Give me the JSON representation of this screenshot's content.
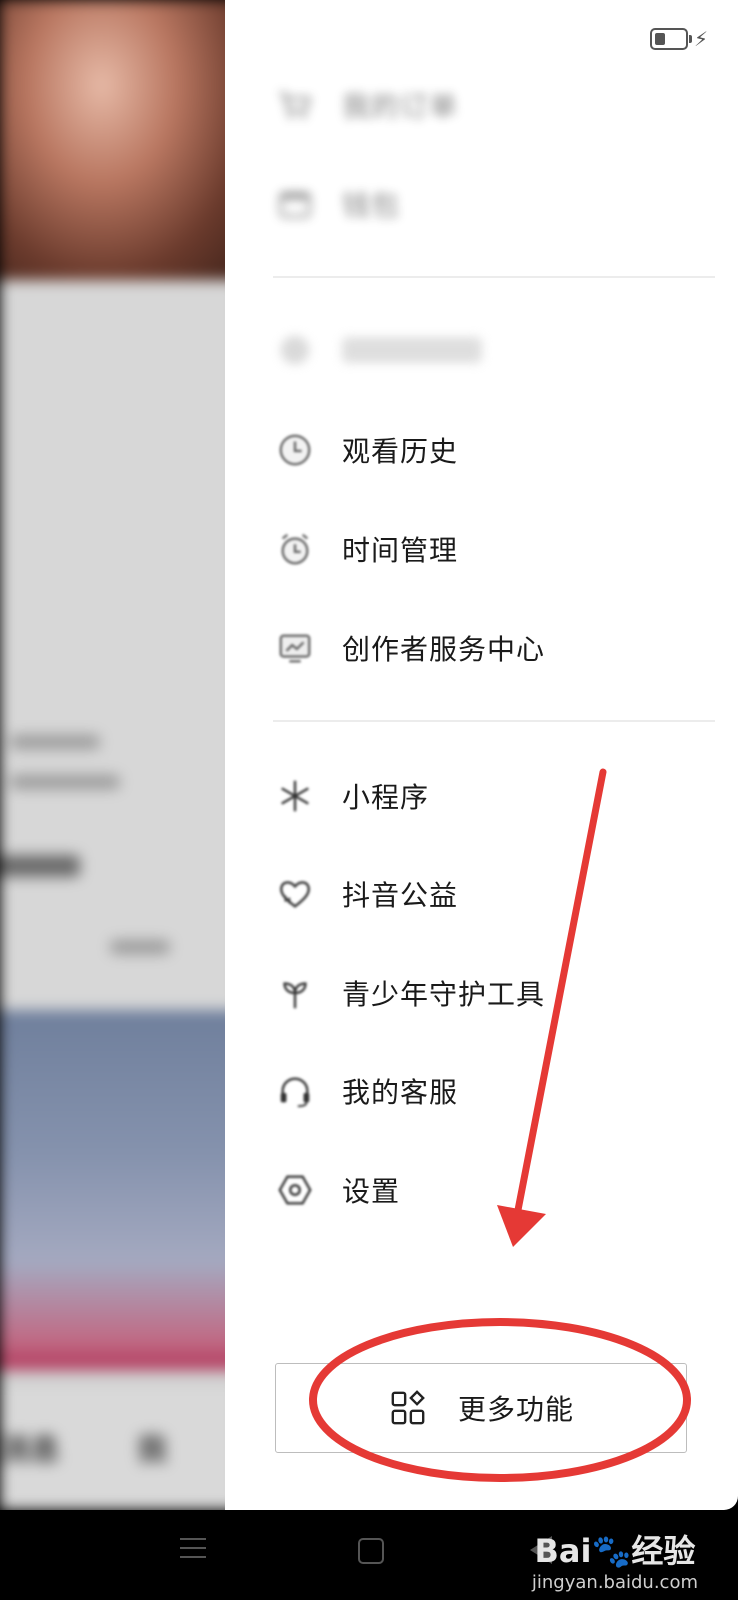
{
  "background_app": {
    "tabs": [
      "消息",
      "我"
    ]
  },
  "status": {
    "battery_icon": "battery-icon",
    "charging_icon": "charging-bolt-icon"
  },
  "drawer": {
    "group1": [
      {
        "id": "orders",
        "label": "我的订单",
        "icon": "cart-icon",
        "blurred": true
      },
      {
        "id": "wallet",
        "label": "钱包",
        "icon": "wallet-icon",
        "blurred": true
      }
    ],
    "group2": [
      {
        "id": "unknown",
        "label": "",
        "icon": "blurred-icon",
        "blurred": true
      },
      {
        "id": "history",
        "label": "观看历史",
        "icon": "clock-icon",
        "blurred": false
      },
      {
        "id": "time",
        "label": "时间管理",
        "icon": "alarm-clock-icon",
        "blurred": false
      },
      {
        "id": "creator",
        "label": "创作者服务中心",
        "icon": "monitor-icon",
        "blurred": false
      }
    ],
    "group3": [
      {
        "id": "miniapp",
        "label": "小程序",
        "icon": "asterisk-icon",
        "blurred": false
      },
      {
        "id": "charity",
        "label": "抖音公益",
        "icon": "heart-icon",
        "blurred": false
      },
      {
        "id": "teen",
        "label": "青少年守护工具",
        "icon": "sprout-icon",
        "blurred": false
      },
      {
        "id": "service",
        "label": "我的客服",
        "icon": "headset-icon",
        "blurred": false
      },
      {
        "id": "settings",
        "label": "设置",
        "icon": "hexagon-gear-icon",
        "blurred": false
      }
    ],
    "more_button": {
      "label": "更多功能",
      "icon": "grid-icon"
    }
  },
  "annotation": {
    "color": "#e53935",
    "shapes": [
      "arrow",
      "ellipse"
    ]
  },
  "navbar": {
    "icons": [
      "menu-icon",
      "home-icon",
      "back-icon"
    ]
  },
  "watermark": {
    "main": "Bai🐾经验",
    "sub": "jingyan.baidu.com"
  }
}
